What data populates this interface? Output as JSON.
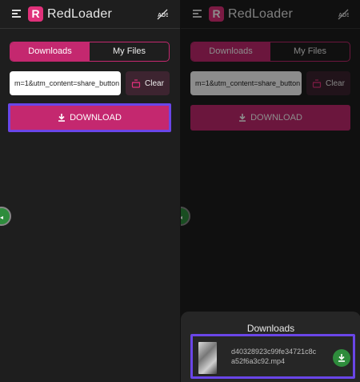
{
  "app": {
    "name": "RedLoader",
    "logo_letter": "R"
  },
  "tabs": [
    {
      "label": "Downloads",
      "active": true
    },
    {
      "label": "My Files",
      "active": false
    }
  ],
  "url_input": {
    "value": "m=1&utm_content=share_button"
  },
  "clear_label": "Clear",
  "download_label": "DOWNLOAD",
  "downloads_sheet": {
    "title": "Downloads",
    "file_name": "d40328923c99fe34721c8ca52f6a3c92.mp4"
  },
  "colors": {
    "accent": "#c4286f",
    "highlight": "#6a46e8",
    "success": "#2e8c3c"
  },
  "icons": [
    "menu-icon",
    "no-ads-icon",
    "download-icon",
    "clear-icon"
  ]
}
